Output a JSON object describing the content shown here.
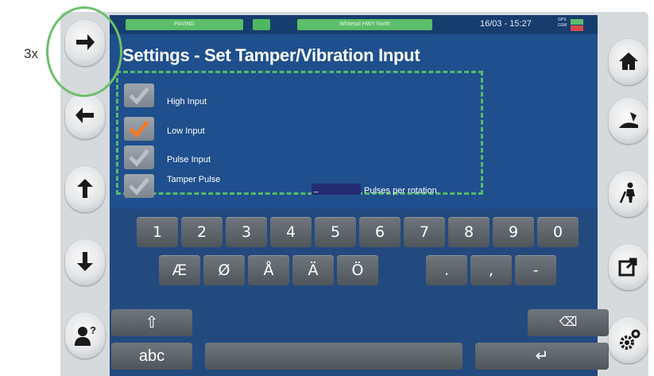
{
  "annotation": {
    "label": "3x"
  },
  "status": {
    "mode": "PAVING",
    "location": "Whitetail HWY North",
    "datetime": "16/03 - 15:27",
    "gps_label": "GPS",
    "gsm_label": "GSM",
    "colors": {
      "ok": "#5cbd6a",
      "error": "#d64a4a"
    }
  },
  "title": "Settings  -  Set Tamper/Vibration Input",
  "options": [
    {
      "label": "High Input",
      "checked": false
    },
    {
      "label": "Low Input",
      "checked": true
    },
    {
      "label": "Pulse Input",
      "checked": false
    },
    {
      "label": "Tamper Pulse",
      "checked": false
    }
  ],
  "pulses": {
    "value": "_",
    "label": "Pulses per rotation"
  },
  "keyboard": {
    "row1": [
      "1",
      "2",
      "3",
      "4",
      "5",
      "6",
      "7",
      "8",
      "9",
      "0"
    ],
    "row2": [
      "Æ",
      "Ø",
      "Å",
      "Ä",
      "Ö"
    ],
    "row2b": [
      ".",
      ",",
      "-"
    ],
    "shift_icon": "⇧",
    "abc_label": "abc",
    "backspace_icon": "⌫",
    "enter_icon": "↵"
  },
  "left_buttons": [
    "arrow-right-icon",
    "arrow-left-icon",
    "arrow-up-icon",
    "arrow-down-icon",
    "help-person-icon"
  ],
  "right_buttons": [
    "home-icon",
    "paver-icon",
    "worker-icon",
    "export-icon",
    "settings-icon"
  ],
  "colors": {
    "screen": "#1f4f8c",
    "accent": "#56b96b",
    "check": "#f07a2a"
  }
}
